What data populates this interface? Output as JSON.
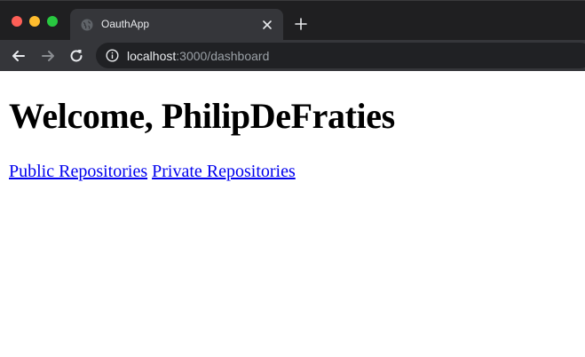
{
  "browser": {
    "tab": {
      "title": "OauthApp",
      "favicon": "globe-icon"
    },
    "address_bar": {
      "host": "localhost",
      "rest": ":3000/dashboard"
    },
    "icons": {
      "back": "arrow-left-icon",
      "forward": "arrow-right-icon",
      "reload": "reload-icon",
      "info": "info-icon",
      "close_tab": "close-icon",
      "new_tab": "plus-icon"
    },
    "colors": {
      "tabstrip": "#1f1f21",
      "toolbar": "#35363a",
      "omnibox": "#202124",
      "close": "#fe5f57",
      "minimize": "#febc2e",
      "maximize": "#28c840",
      "link": "#0000ee"
    }
  },
  "page": {
    "heading": "Welcome, PhilipDeFraties",
    "links": [
      {
        "label": "Public Repositories"
      },
      {
        "label": "Private Repositories"
      }
    ]
  }
}
